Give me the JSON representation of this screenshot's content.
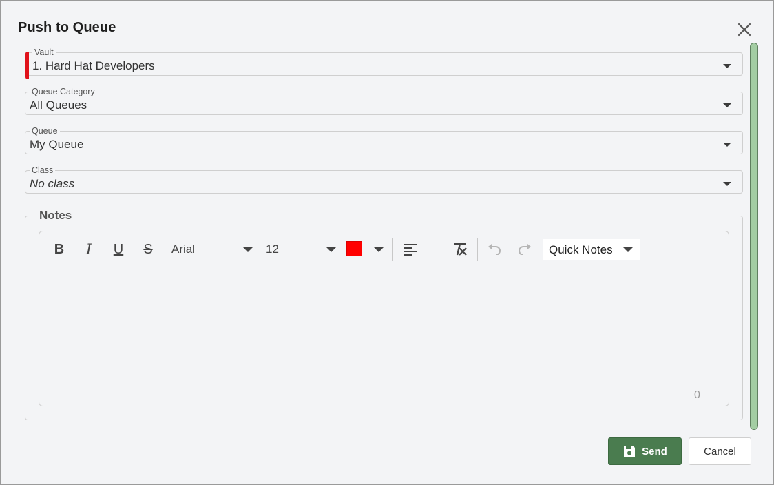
{
  "dialog": {
    "title": "Push to Queue",
    "close_icon": "close-icon"
  },
  "fields": {
    "vault": {
      "label": "Vault",
      "value": "1. Hard Hat Developers",
      "required": true
    },
    "queue_category": {
      "label": "Queue Category",
      "value": "All Queues"
    },
    "queue": {
      "label": "Queue",
      "value": "My Queue"
    },
    "class": {
      "label": "Class",
      "value": "No class"
    }
  },
  "notes": {
    "label": "Notes",
    "toolbar": {
      "bold_label": "B",
      "italic_label": "I",
      "underline_label": "U",
      "strike_label": "S",
      "font_family": "Arial",
      "font_size": "12",
      "text_color": "#ff0000",
      "quick_notes_label": "Quick Notes"
    },
    "content": "",
    "char_count": "0"
  },
  "footer": {
    "send_label": "Send",
    "cancel_label": "Cancel"
  },
  "colors": {
    "accent": "#4a7c4f",
    "required": "#e0121b",
    "scrollbar": "#a3cda3"
  }
}
